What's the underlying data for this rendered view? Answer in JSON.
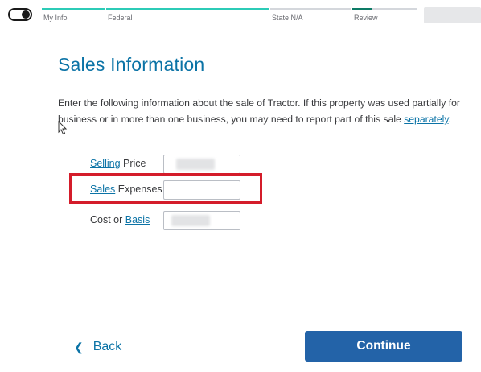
{
  "header": {
    "progress": {
      "steps": [
        {
          "label": "My Info",
          "status": "complete"
        },
        {
          "label": "Federal",
          "status": "current"
        },
        {
          "label": "State N/A",
          "status": "upcoming"
        },
        {
          "label": "Review",
          "status": "upcoming",
          "progress": 0.3
        }
      ],
      "complete_color": "#2ccbb7",
      "upcoming_color": "#d4d7dc"
    }
  },
  "main": {
    "title": "Sales Information",
    "intro_text": "Enter the following information about the sale of Tractor. If this property was used partially for business or in more than one business, you may need to report part of this sale ",
    "intro_link": "separately",
    "intro_end": ".",
    "fields": {
      "selling_price": {
        "link": "Selling",
        "label": " Price",
        "value": ""
      },
      "sales_expenses": {
        "link": "Sales",
        "label": " Expenses",
        "value": ""
      },
      "cost_basis": {
        "label": "Cost or ",
        "link": "Basis",
        "value": ""
      }
    }
  },
  "footer": {
    "back_label": "Back",
    "continue_label": "Continue"
  },
  "colors": {
    "accent": "#0b73a6",
    "primary_button": "#2363a8",
    "highlight": "#d41c2a"
  }
}
